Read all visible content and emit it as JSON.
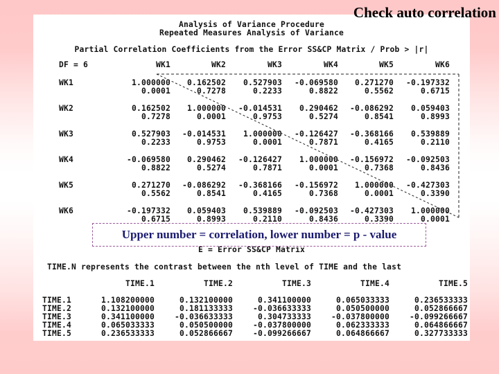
{
  "slide": {
    "title": "Check auto correlation",
    "caption": "Upper number = correlation, lower number =  p - value"
  },
  "output": {
    "header_line1": "Analysis of Variance Procedure",
    "header_line2": "Repeated Measures Analysis of Variance",
    "section_title": "Partial Correlation Coefficients from the Error SS&CP Matrix / Prob > |r|",
    "df_label": "DF = 6",
    "columns": [
      "WK1",
      "WK2",
      "WK3",
      "WK4",
      "WK5",
      "WK6"
    ],
    "rows": [
      {
        "label": "WK1",
        "r": [
          "1.000000",
          "0.162502",
          "0.527903",
          "-0.069580",
          "0.271270",
          "-0.197332"
        ],
        "p": [
          "0.0001",
          "0.7278",
          "0.2233",
          "0.8822",
          "0.5562",
          "0.6715"
        ]
      },
      {
        "label": "WK2",
        "r": [
          "0.162502",
          "1.000000",
          "-0.014531",
          "0.290462",
          "-0.086292",
          "0.059403"
        ],
        "p": [
          "0.7278",
          "0.0001",
          "0.9753",
          "0.5274",
          "0.8541",
          "0.8993"
        ]
      },
      {
        "label": "WK3",
        "r": [
          "0.527903",
          "-0.014531",
          "1.000000",
          "-0.126427",
          "-0.368166",
          "0.539889"
        ],
        "p": [
          "0.2233",
          "0.9753",
          "0.0001",
          "0.7871",
          "0.4165",
          "0.2110"
        ]
      },
      {
        "label": "WK4",
        "r": [
          "-0.069580",
          "0.290462",
          "-0.126427",
          "1.000000",
          "-0.156972",
          "-0.092503"
        ],
        "p": [
          "0.8822",
          "0.5274",
          "0.7871",
          "0.0001",
          "0.7368",
          "0.8436"
        ]
      },
      {
        "label": "WK5",
        "r": [
          "0.271270",
          "-0.086292",
          "-0.368166",
          "-0.156972",
          "1.000000",
          "-0.427303"
        ],
        "p": [
          "0.5562",
          "0.8541",
          "0.4165",
          "0.7368",
          "0.0001",
          "0.3390"
        ]
      },
      {
        "label": "WK6",
        "r": [
          "-0.197332",
          "0.059403",
          "0.539889",
          "-0.092503",
          "-0.427303",
          "1.000000"
        ],
        "p": [
          "0.6715",
          "0.8993",
          "0.2110",
          "0.8436",
          "0.3390",
          "0.0001"
        ]
      }
    ],
    "e_matrix_title": "E = Error SS&CP Matrix",
    "e_matrix_desc": "TIME.N represents the contrast between the nth level of TIME and the last",
    "e_columns": [
      "TIME.1",
      "TIME.2",
      "TIME.3",
      "TIME.4",
      "TIME.5"
    ],
    "e_rows": [
      {
        "label": "TIME.1",
        "values": [
          "1.108200000",
          "0.132100000",
          "0.341100000",
          "0.065033333",
          "0.236533333"
        ]
      },
      {
        "label": "TIME.2",
        "values": [
          "0.132100000",
          "0.181133333",
          "-0.036633333",
          "0.050500000",
          "0.052866667"
        ]
      },
      {
        "label": "TIME.3",
        "values": [
          "0.341100000",
          "-0.036633333",
          "0.304733333",
          "-0.037800000",
          "-0.099266667"
        ]
      },
      {
        "label": "TIME.4",
        "values": [
          "0.065033333",
          "0.050500000",
          "-0.037800000",
          "0.062333333",
          "0.064866667"
        ]
      },
      {
        "label": "TIME.5",
        "values": [
          "0.236533333",
          "0.052866667",
          "-0.099266667",
          "0.064866667",
          "0.327733333"
        ]
      }
    ]
  }
}
